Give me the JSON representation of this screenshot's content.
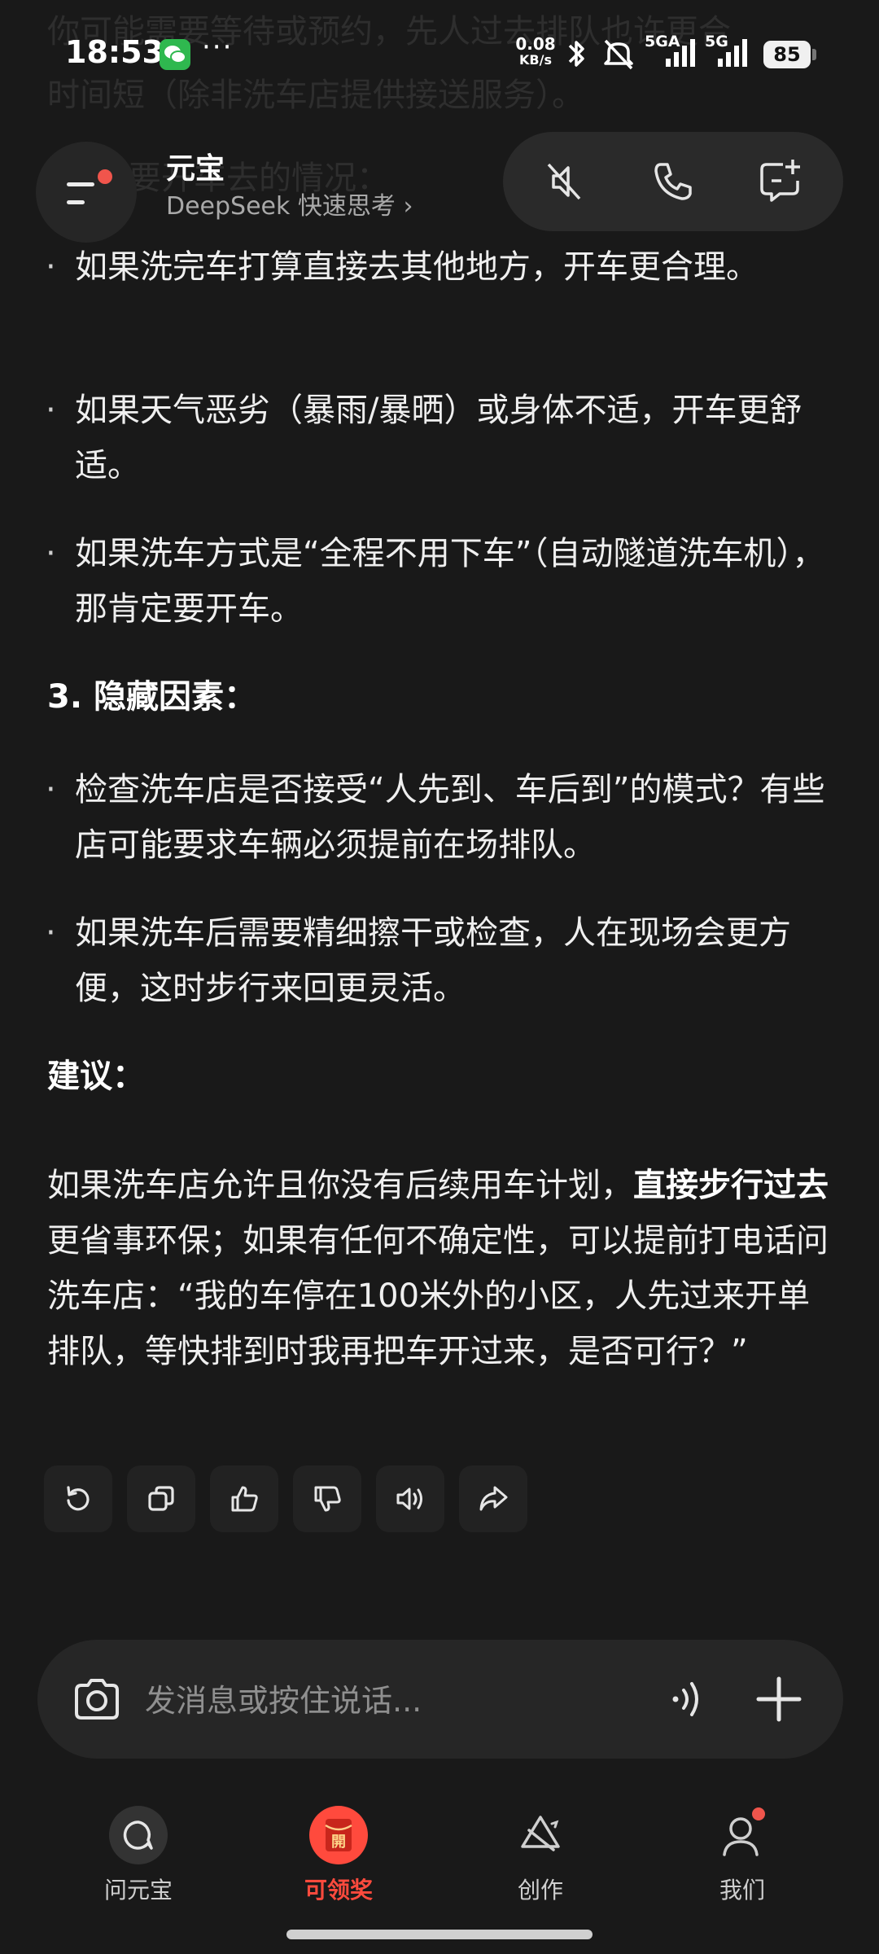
{
  "status_bar": {
    "time": "18:53",
    "more": "···",
    "net_speed_value": "0.08",
    "net_speed_unit": "KB/s",
    "signal1_label": "5GA",
    "signal2_label": "5G",
    "battery": "85"
  },
  "ghost_text": {
    "line1": "你可能需要等待或预约，先人过去排队也许更合",
    "line2": "时间短（除非洗车店提供接送服务）。",
    "line3": "要开车去的情况："
  },
  "header": {
    "title": "元宝",
    "subtitle": "DeepSeek 快速思考 ›"
  },
  "content": {
    "bullets_a": [
      {
        "bullet": "·",
        "text": "如果洗完车打算直接去其他地方，开车更合理。"
      },
      {
        "bullet": "·",
        "text": "如果天气恶劣（暴雨/暴晒）或身体不适，开车更舒适。"
      },
      {
        "bullet": "·",
        "text": "如果洗车方式是“全程不用下车”（自动隧道洗车机），那肯定要开车。"
      }
    ],
    "heading_hidden": "3. 隐藏因素：",
    "bullets_b": [
      {
        "bullet": "·",
        "text": "检查洗车店是否接受“人先到、车后到”的模式？有些店可能要求车辆必须提前在场排队。"
      },
      {
        "bullet": "·",
        "text": "如果洗车后需要精细擦干或检查，人在现场会更方便，这时步行来回更灵活。"
      }
    ],
    "heading_advice": "建议：",
    "advice_pre": "如果洗车店允许且你没有后续用车计划，",
    "advice_bold": "直接步行过去",
    "advice_post": "更省事环保；如果有任何不确定性，可以提前打电话问洗车店：“我的车停在100米外的小区，人先过来开单排队，等快排到时我再把车开过来，是否可行？”"
  },
  "input": {
    "placeholder": "发消息或按住说话..."
  },
  "nav": {
    "items": [
      {
        "label": "问元宝"
      },
      {
        "label": "可领奖",
        "badge": "開"
      },
      {
        "label": "创作"
      },
      {
        "label": "我们"
      }
    ]
  },
  "colors": {
    "background": "#191919",
    "accent_red": "#ff4a3d",
    "badge_dot": "#f0554c",
    "wechat_green": "#2fb84f"
  }
}
